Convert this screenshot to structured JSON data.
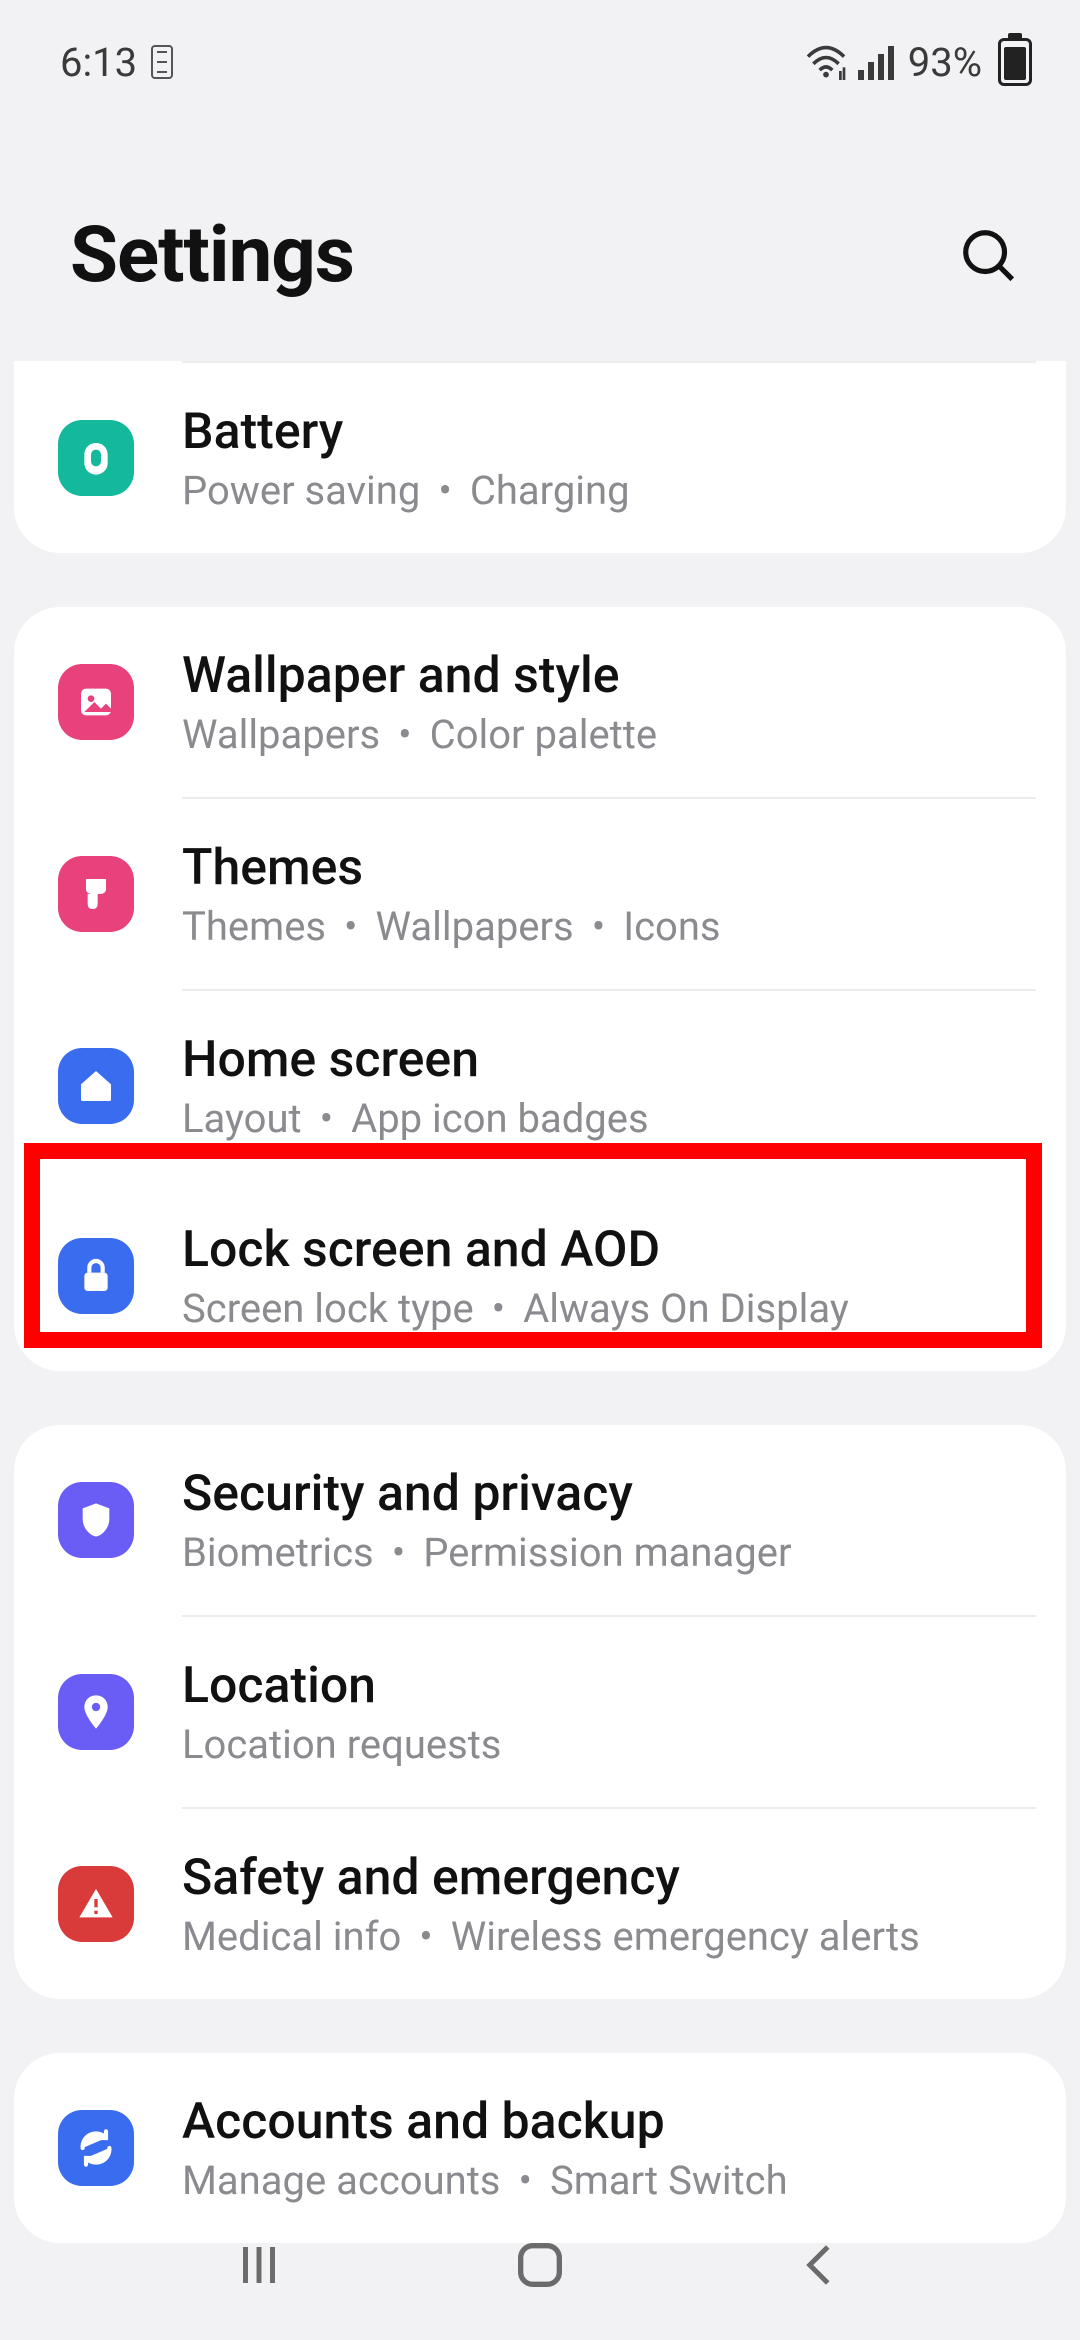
{
  "status": {
    "time": "6:13",
    "battery_pct": "93%"
  },
  "header": {
    "title": "Settings"
  },
  "groups": [
    {
      "items": [
        {
          "icon": "battery-icon",
          "color": "teal",
          "title": "Battery",
          "subs": [
            "Power saving",
            "Charging"
          ]
        }
      ]
    },
    {
      "items": [
        {
          "icon": "image-icon",
          "color": "pink",
          "title": "Wallpaper and style",
          "subs": [
            "Wallpapers",
            "Color palette"
          ]
        },
        {
          "icon": "brush-icon",
          "color": "pink",
          "title": "Themes",
          "subs": [
            "Themes",
            "Wallpapers",
            "Icons"
          ]
        },
        {
          "icon": "home-icon",
          "color": "blue",
          "title": "Home screen",
          "subs": [
            "Layout",
            "App icon badges"
          ]
        },
        {
          "icon": "lock-icon",
          "color": "blue",
          "title": "Lock screen and AOD",
          "subs": [
            "Screen lock type",
            "Always On Display"
          ],
          "highlight": true
        }
      ]
    },
    {
      "items": [
        {
          "icon": "shield-icon",
          "color": "indigo",
          "title": "Security and privacy",
          "subs": [
            "Biometrics",
            "Permission manager"
          ]
        },
        {
          "icon": "location-icon",
          "color": "indigo",
          "title": "Location",
          "subs": [
            "Location requests"
          ]
        },
        {
          "icon": "alert-icon",
          "color": "red",
          "title": "Safety and emergency",
          "subs": [
            "Medical info",
            "Wireless emergency alerts"
          ]
        }
      ]
    },
    {
      "items": [
        {
          "icon": "sync-icon",
          "color": "blue",
          "title": "Accounts and backup",
          "subs": [
            "Manage accounts",
            "Smart Switch"
          ]
        }
      ]
    }
  ]
}
